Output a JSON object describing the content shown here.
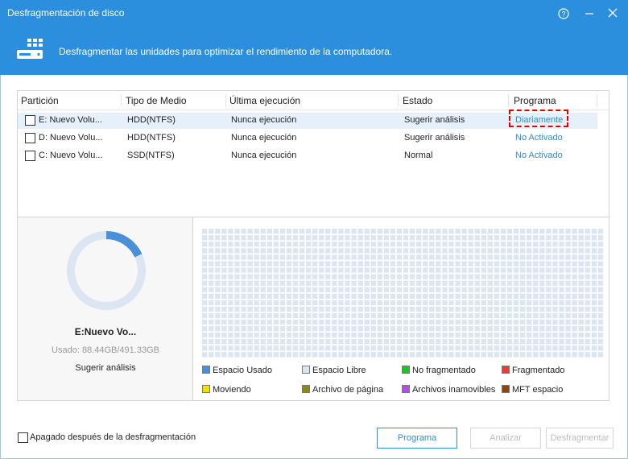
{
  "window": {
    "title": "Desfragmentación de disco"
  },
  "header": {
    "description": "Desfragmentar las unidades para optimizar el rendimiento de la computadora."
  },
  "table": {
    "columns": [
      "Partición",
      "Tipo de Medio",
      "Última ejecución",
      "Estado",
      "Programa"
    ],
    "rows": [
      {
        "partition": "E:  Nuevo Volu...",
        "media": "HDD(NTFS)",
        "last_run": "Nunca ejecución",
        "status": "Sugerir análisis",
        "schedule": "Diariamente"
      },
      {
        "partition": "D:  Nuevo Volu...",
        "media": "HDD(NTFS)",
        "last_run": "Nunca ejecución",
        "status": "Sugerir análisis",
        "schedule": "No Activado"
      },
      {
        "partition": "C:  Nuevo Volu...",
        "media": "SSD(NTFS)",
        "last_run": "Nunca ejecución",
        "status": "Normal",
        "schedule": "No Activado"
      }
    ]
  },
  "detail": {
    "name": "E:Nuevo Vo...",
    "used": "Usado: 88.44GB/491.33GB",
    "used_fraction": 0.18,
    "status": "Sugerir análisis"
  },
  "legend": [
    {
      "label": "Espacio Usado",
      "color": "#4a90d9"
    },
    {
      "label": "Espacio Libre",
      "color": "#dce6f2"
    },
    {
      "label": "No fragmentado",
      "color": "#22c322"
    },
    {
      "label": "Fragmentado",
      "color": "#e83c3c"
    },
    {
      "label": "Moviendo",
      "color": "#f5e000"
    },
    {
      "label": "Archivo de página",
      "color": "#8a8a10"
    },
    {
      "label": "Archivos inamovibles",
      "color": "#b050e0"
    },
    {
      "label": "MFT espacio",
      "color": "#8b4513"
    }
  ],
  "footer": {
    "shutdown_label": "Apagado después de la desfragmentación",
    "schedule_button": "Programa",
    "analyze_button": "Analizar",
    "defrag_button": "Desfragmentar"
  },
  "colors": {
    "accent": "#2b8fde",
    "grid_cell": "#dce6f2"
  },
  "icons": {
    "app": "disk-defrag-icon",
    "help": "help-icon",
    "minimize": "minimize-icon",
    "close": "close-icon"
  }
}
